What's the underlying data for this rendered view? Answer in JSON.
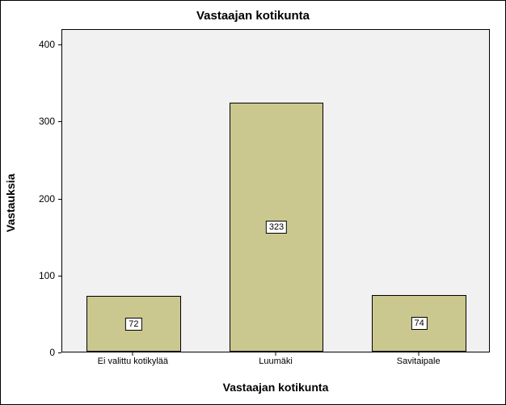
{
  "chart_data": {
    "type": "bar",
    "title": "Vastaajan kotikunta",
    "xlabel": "Vastaajan kotikunta",
    "ylabel": "Vastauksia",
    "ylim": [
      0,
      420
    ],
    "yticks": [
      0,
      100,
      200,
      300,
      400
    ],
    "categories": [
      "Ei valittu kotikylää",
      "Luumäki",
      "Savitaipale"
    ],
    "values": [
      72,
      323,
      74
    ]
  }
}
